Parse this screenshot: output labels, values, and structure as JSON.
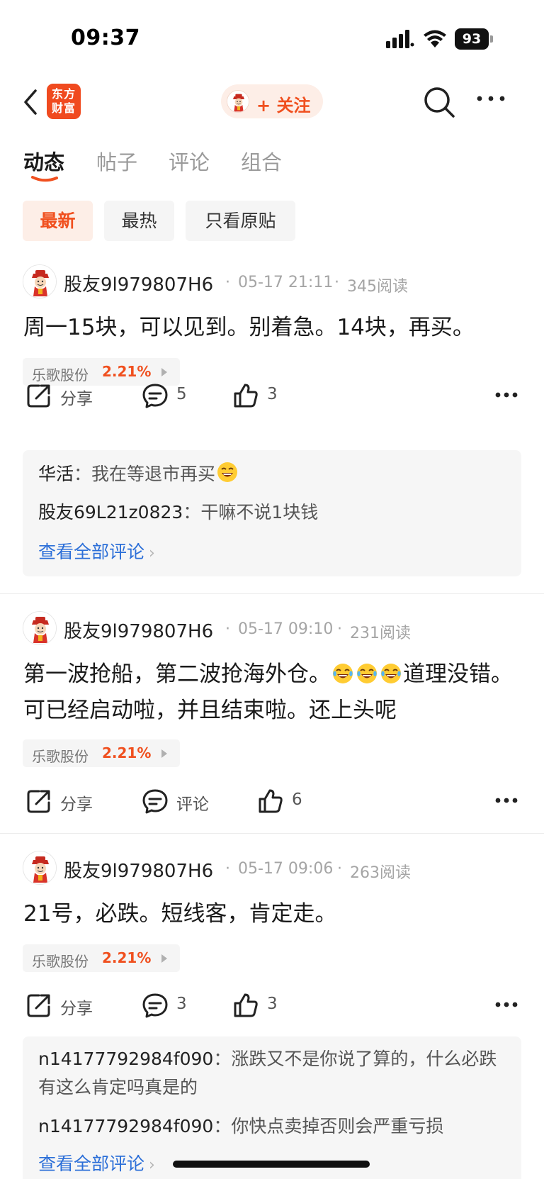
{
  "status_bar": {
    "time": "09:37",
    "battery": "93"
  },
  "nav": {
    "logo_text_line1": "东方",
    "logo_text_line2": "财富",
    "follow_label": "+ 关注"
  },
  "tabs": [
    {
      "label": "动态",
      "active": true
    },
    {
      "label": "帖子",
      "active": false
    },
    {
      "label": "评论",
      "active": false
    },
    {
      "label": "组合",
      "active": false
    }
  ],
  "filters": [
    {
      "label": "最新",
      "active": true
    },
    {
      "label": "最热",
      "active": false
    },
    {
      "label": "只看原贴",
      "active": false
    }
  ],
  "posts": [
    {
      "username": "股友9l979807H6",
      "time": "05-17 21:11",
      "reads": "345阅读",
      "text": "周一15块，可以见到。别着急。14块，再买。",
      "stock": {
        "name": "乐歌股份",
        "change": "2.21%"
      },
      "share_label": "分享",
      "comment_label": "5",
      "like_label": "3",
      "comments": [
        {
          "name": "华活",
          "text": "我在等退市再买"
        },
        {
          "name": "股友69L21z0823",
          "text": "干嘛不说1块钱"
        }
      ],
      "view_all": "查看全部评论"
    },
    {
      "username": "股友9l979807H6",
      "time": "05-17 09:10",
      "reads": "231阅读",
      "text_part1": "第一波抢船，第二波抢海外仓。",
      "text_part2": "道理没错。可已经启动啦，并且结束啦。还上头呢",
      "stock": {
        "name": "乐歌股份",
        "change": "2.21%"
      },
      "share_label": "分享",
      "comment_label": "评论",
      "like_label": "6"
    },
    {
      "username": "股友9l979807H6",
      "time": "05-17 09:06",
      "reads": "263阅读",
      "text": "21号，必跌。短线客，肯定走。",
      "stock": {
        "name": "乐歌股份",
        "change": "2.21%"
      },
      "share_label": "分享",
      "comment_label": "3",
      "like_label": "3",
      "comments": [
        {
          "name": "n14177792984f090",
          "text": "涨跌又不是你说了算的，什么必跌有这么肯定吗真是的"
        },
        {
          "name": "n14177792984f090",
          "text": "你快点卖掉否则会严重亏损"
        }
      ],
      "view_all": "查看全部评论"
    }
  ],
  "colors": {
    "accent": "#f0501f",
    "link": "#2c6fd8",
    "muted": "#a5a5a5"
  }
}
